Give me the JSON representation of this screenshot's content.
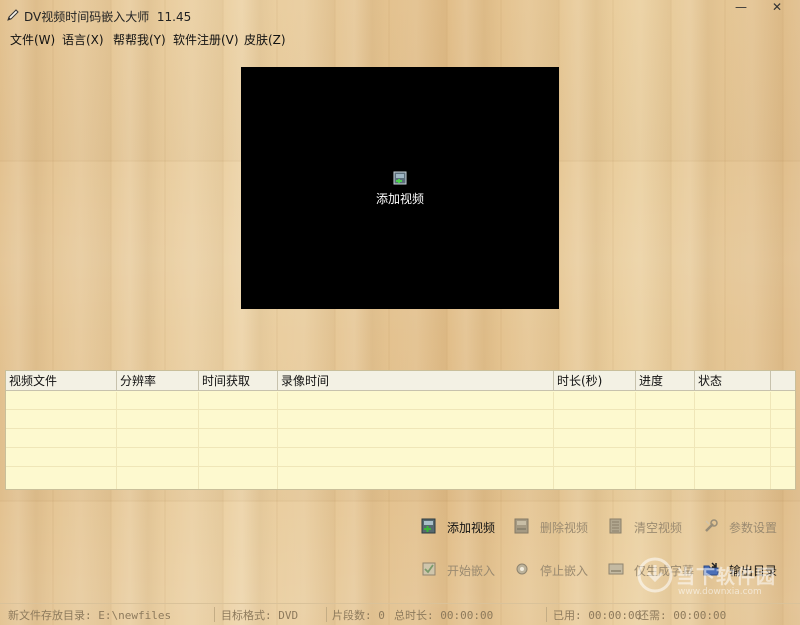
{
  "window": {
    "title": "DV视频时间码嵌入大师  11.45",
    "minimize": "—",
    "close": "✕"
  },
  "menu": [
    "文件(W)",
    "语言(X)",
    "帮帮我(Y)",
    "软件注册(V)",
    "皮肤(Z)"
  ],
  "preview": {
    "add_label": "添加视频"
  },
  "table": {
    "columns": [
      "视频文件",
      "分辨率",
      "时间获取",
      "录像时间",
      "时长(秒)",
      "进度",
      "状态"
    ]
  },
  "actions": {
    "row1": [
      {
        "label": "添加视频",
        "icon": "film-add-icon",
        "enabled": true
      },
      {
        "label": "删除视频",
        "icon": "film-delete-icon",
        "enabled": false
      },
      {
        "label": "清空视频",
        "icon": "film-clear-icon",
        "enabled": false
      },
      {
        "label": "参数设置",
        "icon": "wrench-icon",
        "enabled": false
      }
    ],
    "row2": [
      {
        "label": "开始嵌入",
        "icon": "checkbox-icon",
        "enabled": false
      },
      {
        "label": "停止嵌入",
        "icon": "stop-dot-icon",
        "enabled": false
      },
      {
        "label": "仅生成字幕",
        "icon": "subtitle-icon",
        "enabled": false
      },
      {
        "label": "输出目录",
        "icon": "folder-output-icon",
        "enabled": true
      }
    ]
  },
  "status": {
    "output_dir": "新文件存放目录: E:\\newfiles",
    "format": "目标格式: DVD",
    "segments": "片段数: 0",
    "total_duration": "总时长: 00:00:00",
    "elapsed": "已用: 00:00:00",
    "remaining": "还需: 00:00:00"
  },
  "watermark": {
    "text": "当下软件园",
    "url": "www.downxia.com"
  }
}
